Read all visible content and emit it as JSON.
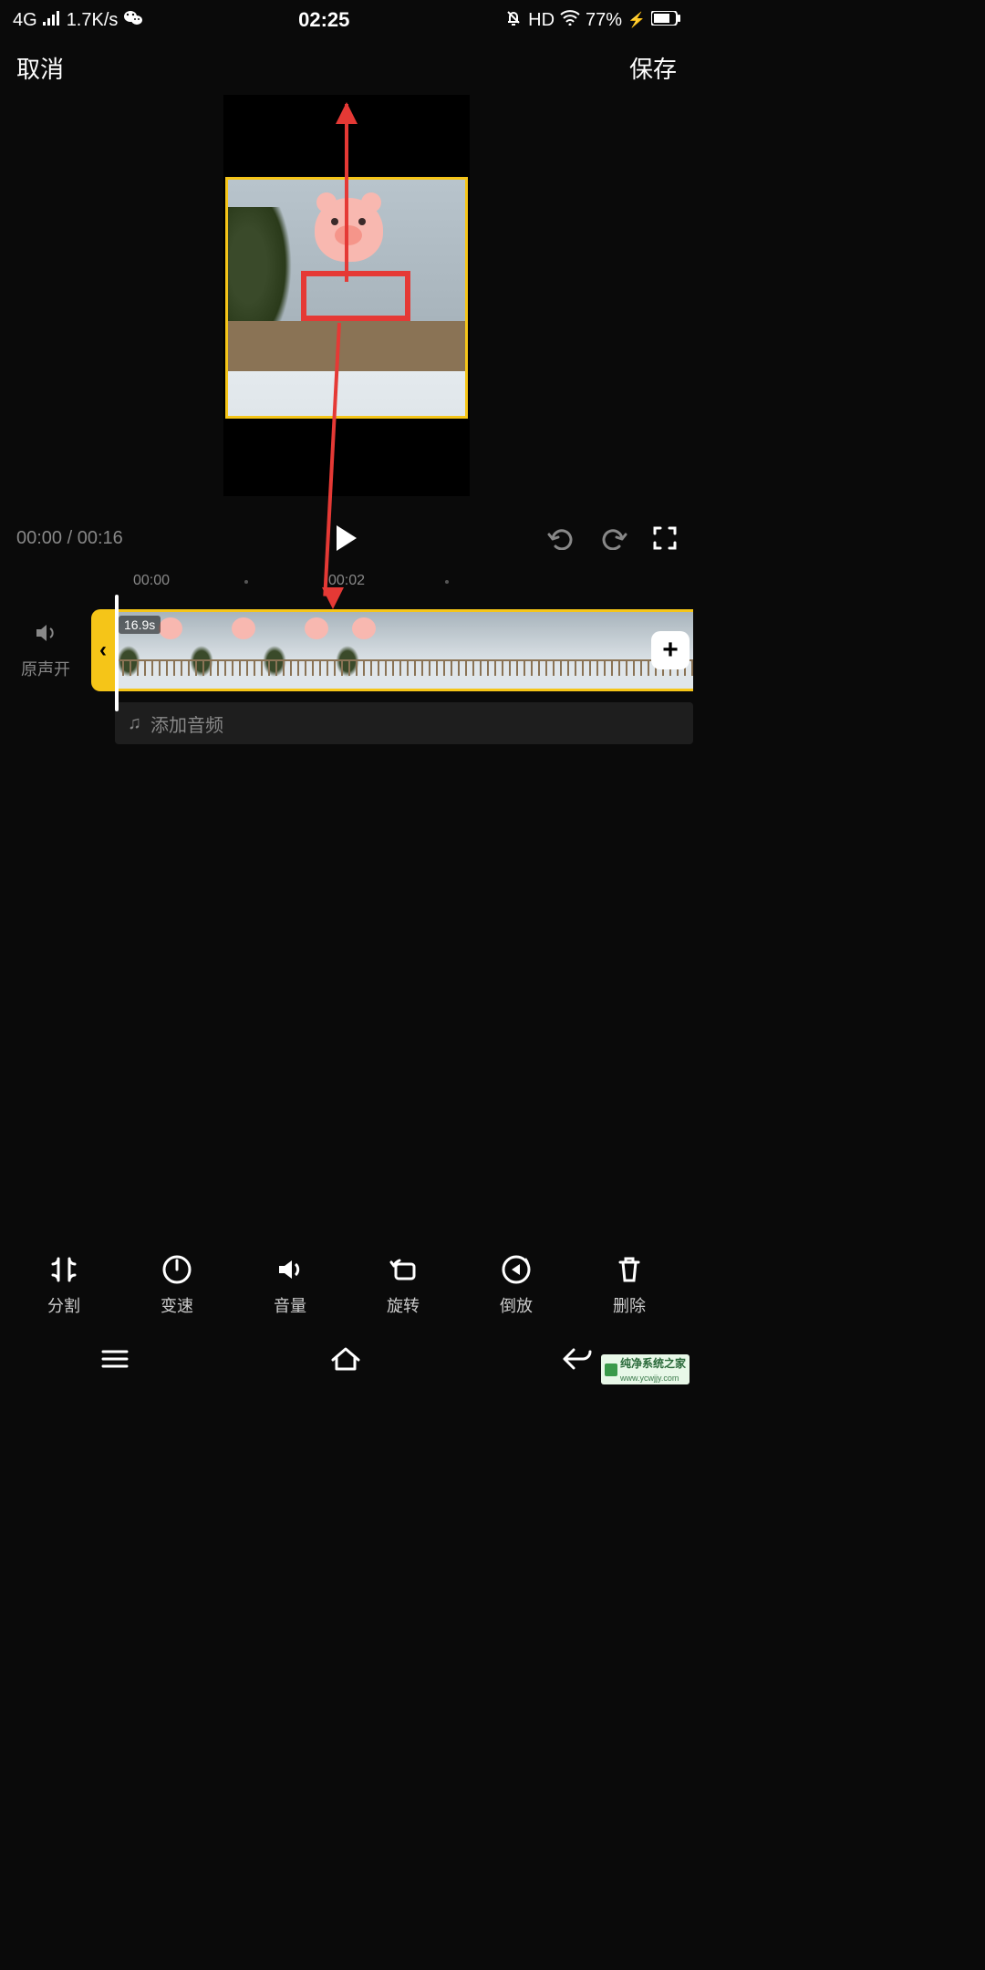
{
  "status": {
    "network": "4G",
    "speed": "1.7K/s",
    "time": "02:25",
    "hd": "HD",
    "battery": "77%"
  },
  "header": {
    "cancel": "取消",
    "save": "保存"
  },
  "playback": {
    "current": "00:00",
    "separator": " / ",
    "total": "00:16"
  },
  "ruler": {
    "t0": "00:00",
    "t1": "00:02"
  },
  "timeline": {
    "sound_label": "原声开",
    "clip_duration": "16.9s",
    "add_audio": "添加音频"
  },
  "tools": [
    {
      "id": "split",
      "label": "分割"
    },
    {
      "id": "speed",
      "label": "变速"
    },
    {
      "id": "volume",
      "label": "音量"
    },
    {
      "id": "rotate",
      "label": "旋转"
    },
    {
      "id": "reverse",
      "label": "倒放"
    },
    {
      "id": "delete",
      "label": "删除"
    }
  ],
  "watermark": {
    "brand": "纯净系统之家",
    "url": "www.ycwjjy.com"
  },
  "colors": {
    "accent": "#f5c518",
    "annotation": "#e53935"
  }
}
